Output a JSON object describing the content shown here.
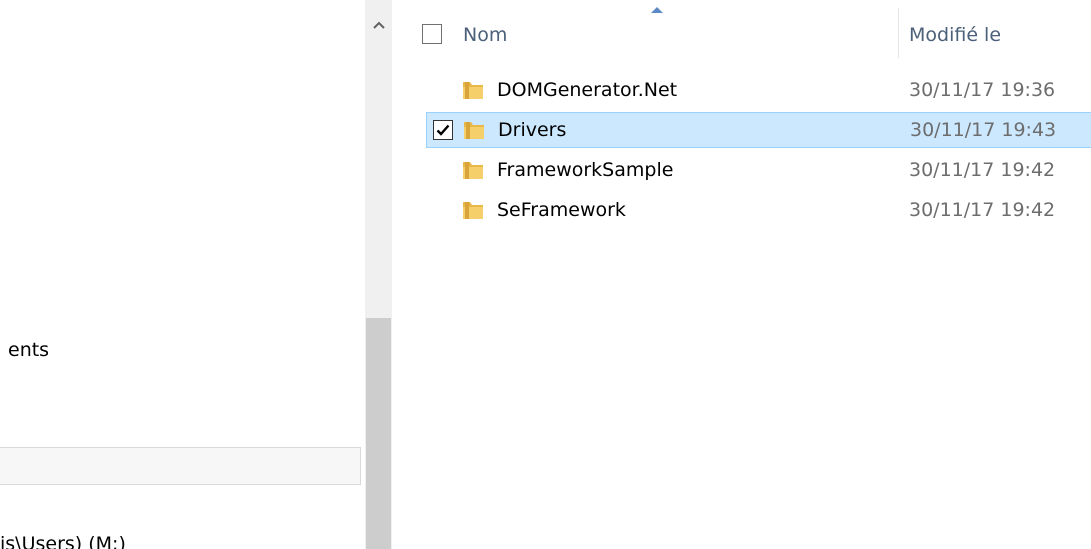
{
  "nav": {
    "partial_item": "ents",
    "bottom_item": "is\\Users) (M:)"
  },
  "header": {
    "name_label": "Nom",
    "modified_label": "Modifié le"
  },
  "files": [
    {
      "name": "DOMGenerator.Net",
      "modified": "30/11/17 19:36",
      "type": "folder",
      "selected": false
    },
    {
      "name": "Drivers",
      "modified": "30/11/17 19:43",
      "type": "folder",
      "selected": true
    },
    {
      "name": "FrameworkSample",
      "modified": "30/11/17 19:42",
      "type": "folder",
      "selected": false
    },
    {
      "name": "SeFramework",
      "modified": "30/11/17 19:42",
      "type": "folder",
      "selected": false
    }
  ],
  "colors": {
    "selection_bg": "#cce8ff",
    "selection_border": "#99d1ff",
    "header_text": "#4c607a",
    "folder": "#e8b84a"
  }
}
